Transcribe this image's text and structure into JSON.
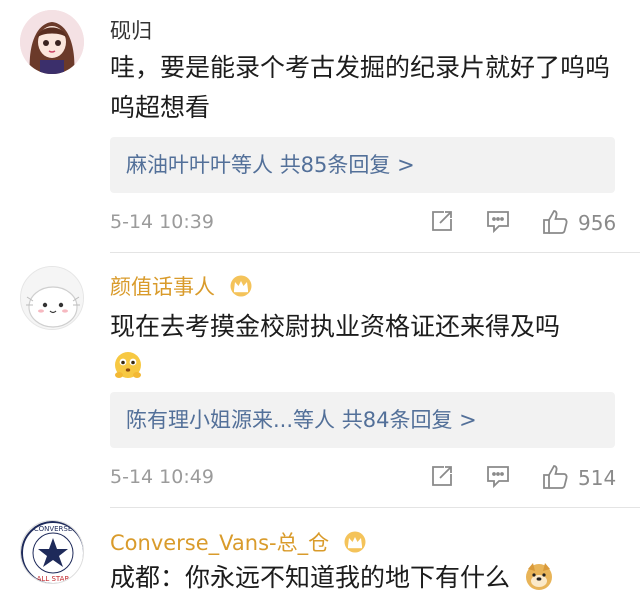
{
  "comments": [
    {
      "username": "砚归",
      "text": "哇，要是能录个考古发掘的纪录片就好了呜呜呜超想看",
      "reply_preview": "麻油叶叶叶等人",
      "reply_count": "共85条回复 >",
      "time": "5-14 10:39",
      "likes": "956"
    },
    {
      "username": "颜值话事人",
      "text": "现在去考摸金校尉执业资格证还来得及吗",
      "reply_preview": "陈有理小姐源来...等人",
      "reply_count": "共84条回复 >",
      "time": "5-14 10:49",
      "likes": "514"
    },
    {
      "username": "Converse_Vans-总_仓",
      "text": "成都：你永远不知道我的地下有什么"
    }
  ],
  "icons": {
    "share": "share-icon",
    "comment": "comment-icon",
    "like": "thumbs-up-icon",
    "vip": "crown-badge-icon"
  },
  "colors": {
    "link": "#537099",
    "gold_name": "#d99b2b",
    "meta_gray": "#9b9b9b",
    "reply_bg": "#f2f2f2"
  }
}
